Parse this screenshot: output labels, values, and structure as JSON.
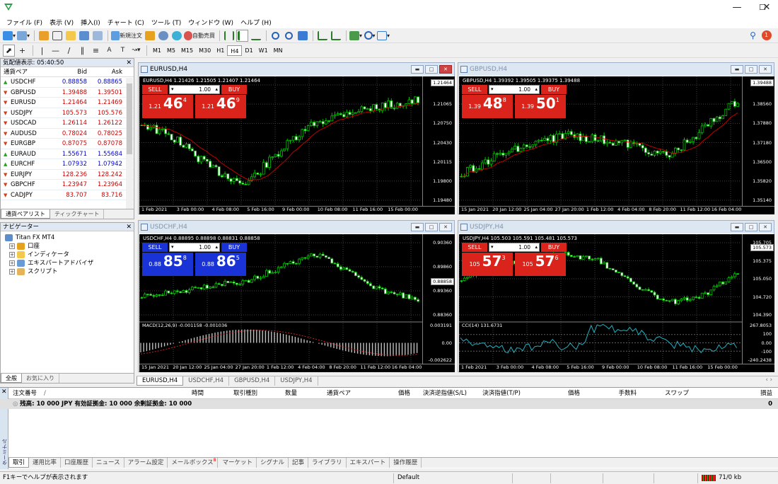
{
  "menu": [
    "ファイル (F)",
    "表示 (V)",
    "挿入(I)",
    "チャート (C)",
    "ツール (T)",
    "ウィンドウ (W)",
    "ヘルプ (H)"
  ],
  "toolbar1": {
    "new_order": "新規注文",
    "auto_trade": "自動売買",
    "notif_count": "1"
  },
  "timeframes": [
    "M1",
    "M5",
    "M15",
    "M30",
    "H1",
    "H4",
    "D1",
    "W1",
    "MN"
  ],
  "timeframe_active": "H4",
  "market_watch": {
    "title": "気配値表示: 05:40:50",
    "headers": {
      "symbol": "通貨ペア",
      "bid": "Bid",
      "ask": "Ask"
    },
    "rows": [
      {
        "symbol": "USDCHF",
        "bid": "0.88858",
        "ask": "0.88865",
        "dir": "up"
      },
      {
        "symbol": "GBPUSD",
        "bid": "1.39488",
        "ask": "1.39501",
        "dir": "down"
      },
      {
        "symbol": "EURUSD",
        "bid": "1.21464",
        "ask": "1.21469",
        "dir": "down"
      },
      {
        "symbol": "USDJPY",
        "bid": "105.573",
        "ask": "105.576",
        "dir": "down"
      },
      {
        "symbol": "USDCAD",
        "bid": "1.26114",
        "ask": "1.26122",
        "dir": "down"
      },
      {
        "symbol": "AUDUSD",
        "bid": "0.78024",
        "ask": "0.78025",
        "dir": "down"
      },
      {
        "symbol": "EURGBP",
        "bid": "0.87075",
        "ask": "0.87078",
        "dir": "down"
      },
      {
        "symbol": "EURAUD",
        "bid": "1.55671",
        "ask": "1.55684",
        "dir": "up"
      },
      {
        "symbol": "EURCHF",
        "bid": "1.07932",
        "ask": "1.07942",
        "dir": "up"
      },
      {
        "symbol": "EURJPY",
        "bid": "128.236",
        "ask": "128.242",
        "dir": "down"
      },
      {
        "symbol": "GBPCHF",
        "bid": "1.23947",
        "ask": "1.23964",
        "dir": "down"
      },
      {
        "symbol": "CADJPY",
        "bid": "83.707",
        "ask": "83.716",
        "dir": "down"
      }
    ],
    "tabs": [
      "通貨ペアリスト",
      "ティックチャート"
    ]
  },
  "navigator": {
    "title": "ナビゲーター",
    "root": "Titan FX MT4",
    "items": [
      "口座",
      "インディケータ",
      "エキスパートアドバイザ",
      "スクリプト"
    ],
    "tabs": [
      "全般",
      "お気に入り"
    ]
  },
  "charts": {
    "eurusd": {
      "title": "EURUSD,H4",
      "info": "EURUSD,H4  1.21426 1.21505 1.21407 1.21464",
      "sell": "SELL",
      "buy": "BUY",
      "volume": "1.00",
      "bid_small": "1.21",
      "bid_big": "46",
      "bid_sup": "4",
      "ask_small": "1.21",
      "ask_big": "46",
      "ask_sup": "9",
      "yticks": [
        "1.21380",
        "1.21065",
        "1.20750",
        "1.20430",
        "1.20115",
        "1.19800",
        "1.19480"
      ],
      "price_label": "1.21464",
      "xticks": [
        "1 Feb 2021",
        "3 Feb 00:00",
        "4 Feb 08:00",
        "5 Feb 16:00",
        "9 Feb 00:00",
        "10 Feb 08:00",
        "11 Feb 16:00",
        "15 Feb 00:00"
      ]
    },
    "gbpusd": {
      "title": "GBPUSD,H4",
      "info": "GBPUSD,H4  1.39392 1.39505 1.39375 1.39488",
      "sell": "SELL",
      "buy": "BUY",
      "volume": "1.00",
      "bid_small": "1.39",
      "bid_big": "48",
      "bid_sup": "8",
      "ask_small": "1.39",
      "ask_big": "50",
      "ask_sup": "1",
      "yticks": [
        "1.39240",
        "1.38560",
        "1.37880",
        "1.37180",
        "1.36500",
        "1.35820",
        "1.35140"
      ],
      "price_label": "1.39488",
      "xticks": [
        "15 Jan 2021",
        "20 Jan 12:00",
        "25 Jan 04:00",
        "27 Jan 20:00",
        "1 Feb 12:00",
        "4 Feb 04:00",
        "8 Feb 20:00",
        "11 Feb 12:00",
        "16 Feb 04:00"
      ]
    },
    "usdchf": {
      "title": "USDCHF,H4",
      "info": "USDCHF,H4  0.88895 0.88898 0.88831 0.88858",
      "sell": "SELL",
      "buy": "BUY",
      "volume": "1.00",
      "bid_small": "0.88",
      "bid_big": "85",
      "bid_sup": "8",
      "ask_small": "0.88",
      "ask_big": "86",
      "ask_sup": "5",
      "yticks": [
        "0.90360",
        "0.89860",
        "0.89360",
        "0.88360"
      ],
      "price_label": "0.88858",
      "sub_label": "MACD(12,26,9) -0.001158 -0.001036",
      "sub_yticks": [
        "0.003191",
        "0.00",
        "-0.002622"
      ],
      "xticks": [
        "15 Jan 2021",
        "20 Jan 12:00",
        "25 Jan 04:00",
        "27 Jan 20:00",
        "1 Feb 12:00",
        "4 Feb 04:00",
        "8 Feb 20:00",
        "11 Feb 12:00",
        "16 Feb 04:00"
      ]
    },
    "usdjpy": {
      "title": "USDJPY,H4",
      "info": "USDJPY,H4  105.503 105.591 105.481 105.573",
      "sell": "SELL",
      "buy": "BUY",
      "volume": "1.00",
      "bid_small": "105",
      "bid_big": "57",
      "bid_sup": "3",
      "ask_small": "105",
      "ask_big": "57",
      "ask_sup": "6",
      "yticks": [
        "105.705",
        "105.375",
        "105.050",
        "104.720",
        "104.390"
      ],
      "price_label": "105.573",
      "sub_label": "CCI(14) 131.6731",
      "sub_yticks": [
        "267.8053",
        "100",
        "0.00",
        "-100",
        "-240.2438"
      ],
      "xticks": [
        "1 Feb 2021",
        "3 Feb 00:00",
        "4 Feb 08:00",
        "5 Feb 16:00",
        "9 Feb 00:00",
        "10 Feb 08:00",
        "11 Feb 16:00",
        "15 Feb 00:00"
      ]
    }
  },
  "chart_tabs": [
    "EURUSD,H4",
    "USDCHF,H4",
    "GBPUSD,H4",
    "USDJPY,H4"
  ],
  "terminal": {
    "headers": [
      "注文番号",
      "/",
      "時間",
      "取引種別",
      "数量",
      "通貨ペア",
      "価格",
      "決済逆指値(S/L)",
      "決済指値(T/P)",
      "価格",
      "手数料",
      "スワップ",
      "損益"
    ],
    "balance": "残高: 10 000 JPY  有効証拠金: 10 000  余剰証拠金: 10 000",
    "balance_pl": "0",
    "side_label": "ターミナル",
    "tabs": [
      "取引",
      "運用比率",
      "口座履歴",
      "ニュース",
      "アラーム設定",
      "メールボックス",
      "マーケット",
      "シグナル",
      "記事",
      "ライブラリ",
      "エキスパート",
      "操作履歴"
    ],
    "mailbox_badge": "8"
  },
  "status": {
    "help": "F1キーでヘルプが表示されます",
    "profile": "Default",
    "traffic": "71/0 kb"
  },
  "colors": {
    "sell_red": "#d9231b",
    "buy_red": "#d9231b",
    "sell_blue": "#1a33d6",
    "bull": "#00c000",
    "bear": "#ffffff",
    "ma": "#c00000"
  }
}
